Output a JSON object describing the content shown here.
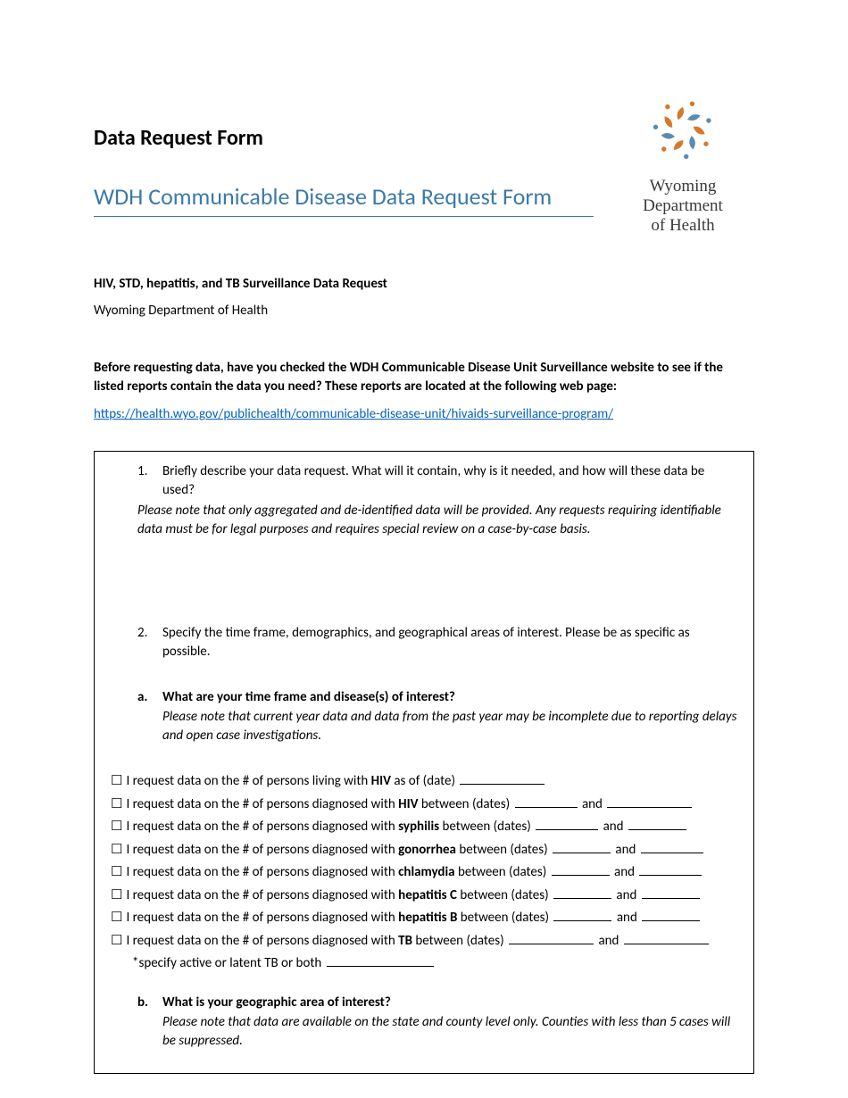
{
  "header": {
    "page_title": "Data Request Form",
    "form_title": "WDH Communicable Disease Data Request Form",
    "logo_line1": "Wyoming",
    "logo_line2": "Department",
    "logo_line3": "of Health"
  },
  "intro": {
    "section_title": "HIV, STD, hepatitis, and TB Surveillance Data Request",
    "dept": "Wyoming Department of Health",
    "check_text": "Before requesting data, have you checked the WDH Communicable Disease Unit Surveillance website to see if the listed reports contain the data you need? These reports are located at the following web page:",
    "url": "https://health.wyo.gov/publichealth/communicable-disease-unit/hivaids-surveillance-program/"
  },
  "q1": {
    "num": "1.",
    "text": "Briefly describe your data request. What will it contain, why is it needed, and how will these data be used?",
    "note": "Please note that only aggregated and de-identified data will be provided. Any requests requiring identifiable data must be for legal purposes and requires special review on a case-by-case basis."
  },
  "q2": {
    "num": "2.",
    "text": "Specify the time frame, demographics, and geographical areas of interest. Please be as specific as possible."
  },
  "q2a": {
    "letter": "a.",
    "title": "What are your time frame and disease(s) of interest?",
    "note": "Please note that current year data and data from the past year may be incomplete due to reporting delays and open case investigations."
  },
  "checks": {
    "prefix_living": "I request data on the # of persons living with ",
    "prefix_diag": "I request data on the # of persons diagnosed with ",
    "asof": " as of (date) ",
    "between": " between (dates) ",
    "and": " and ",
    "hiv": "HIV",
    "syphilis": "syphilis",
    "gonorrhea": "gonorrhea",
    "chlamydia": "chlamydia",
    "hepc": "hepatitis C",
    "hepb": "hepatitis B",
    "tb": "TB",
    "tb_note": "*specify active or latent TB or both "
  },
  "q2b": {
    "letter": "b.",
    "title": "What is your geographic area of interest?",
    "note": "Please note that data are available on the state and county level only. Counties with less than 5 cases will be suppressed."
  }
}
